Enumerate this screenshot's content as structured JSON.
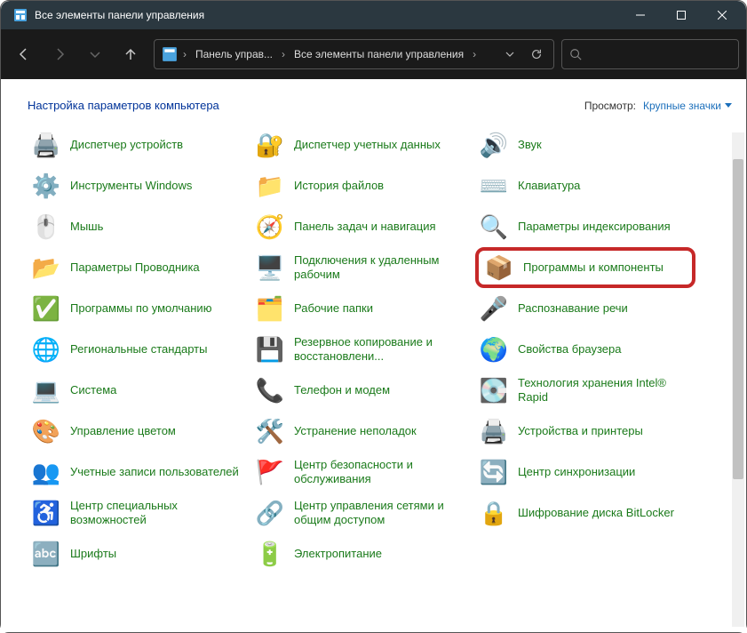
{
  "window": {
    "title": "Все элементы панели управления"
  },
  "breadcrumb": {
    "seg1": "Панель управ...",
    "seg2": "Все элементы панели управления"
  },
  "header": {
    "title": "Настройка параметров компьютера",
    "view_label": "Просмотр:",
    "view_value": "Крупные значки"
  },
  "items": [
    {
      "label": "Диспетчер устройств",
      "icon": "🖨️",
      "highlight": false
    },
    {
      "label": "Диспетчер учетных данных",
      "icon": "🔐",
      "highlight": false
    },
    {
      "label": "Звук",
      "icon": "🔊",
      "highlight": false
    },
    {
      "label": "Инструменты Windows",
      "icon": "⚙️",
      "highlight": false
    },
    {
      "label": "История файлов",
      "icon": "📁",
      "highlight": false
    },
    {
      "label": "Клавиатура",
      "icon": "⌨️",
      "highlight": false
    },
    {
      "label": "Мышь",
      "icon": "🖱️",
      "highlight": false
    },
    {
      "label": "Панель задач и навигация",
      "icon": "🧭",
      "highlight": false
    },
    {
      "label": "Параметры индексирования",
      "icon": "🔍",
      "highlight": false
    },
    {
      "label": "Параметры Проводника",
      "icon": "📂",
      "highlight": false
    },
    {
      "label": "Подключения к удаленным рабочим",
      "icon": "🖥️",
      "highlight": false
    },
    {
      "label": "Программы и компоненты",
      "icon": "📦",
      "highlight": true
    },
    {
      "label": "Программы по умолчанию",
      "icon": "✅",
      "highlight": false
    },
    {
      "label": "Рабочие папки",
      "icon": "🗂️",
      "highlight": false
    },
    {
      "label": "Распознавание речи",
      "icon": "🎤",
      "highlight": false
    },
    {
      "label": "Региональные стандарты",
      "icon": "🌐",
      "highlight": false
    },
    {
      "label": "Резервное копирование и восстановлени...",
      "icon": "💾",
      "highlight": false
    },
    {
      "label": "Свойства браузера",
      "icon": "🌍",
      "highlight": false
    },
    {
      "label": "Система",
      "icon": "💻",
      "highlight": false
    },
    {
      "label": "Телефон и модем",
      "icon": "📞",
      "highlight": false
    },
    {
      "label": "Технология хранения Intel® Rapid",
      "icon": "💽",
      "highlight": false
    },
    {
      "label": "Управление цветом",
      "icon": "🎨",
      "highlight": false
    },
    {
      "label": "Устранение неполадок",
      "icon": "🛠️",
      "highlight": false
    },
    {
      "label": "Устройства и принтеры",
      "icon": "🖨️",
      "highlight": false
    },
    {
      "label": "Учетные записи пользователей",
      "icon": "👥",
      "highlight": false
    },
    {
      "label": "Центр безопасности и обслуживания",
      "icon": "🚩",
      "highlight": false
    },
    {
      "label": "Центр синхронизации",
      "icon": "🔄",
      "highlight": false
    },
    {
      "label": "Центр специальных возможностей",
      "icon": "♿",
      "highlight": false
    },
    {
      "label": "Центр управления сетями и общим доступом",
      "icon": "🔗",
      "highlight": false
    },
    {
      "label": "Шифрование диска BitLocker",
      "icon": "🔒",
      "highlight": false
    },
    {
      "label": "Шрифты",
      "icon": "🔤",
      "highlight": false
    },
    {
      "label": "Электропитание",
      "icon": "🔋",
      "highlight": false
    }
  ]
}
